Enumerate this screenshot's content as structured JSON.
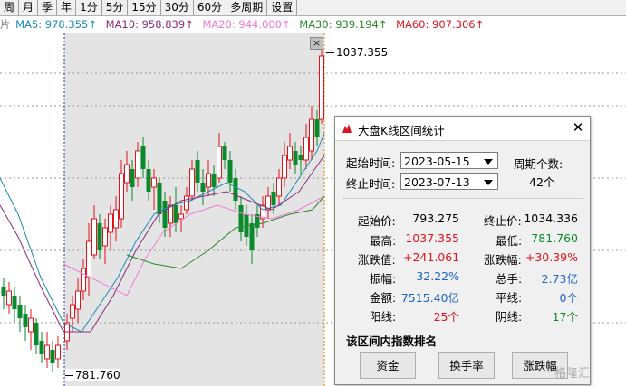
{
  "toolbar": {
    "items": [
      "周",
      "月",
      "季",
      "年",
      "1分",
      "5分",
      "15分",
      "30分",
      "60分",
      "多周期",
      "设置"
    ]
  },
  "ma_legend": {
    "prefix": "片",
    "items": [
      {
        "text": "MA5: 978.355↑",
        "color": "#1b8ab5"
      },
      {
        "text": "MA10: 958.839↑",
        "color": "#8a2b7a"
      },
      {
        "text": "MA20: 944.000↑",
        "color": "#f07ad8"
      },
      {
        "text": "MA30: 939.194↑",
        "color": "#2a8a2a"
      },
      {
        "text": "MA60: 907.306↑",
        "color": "#1a5a9a"
      }
    ]
  },
  "price_labels": {
    "high": "1037.355",
    "low": "781.760"
  },
  "dialog": {
    "title": "大盘K线区间统计",
    "start_label": "起始时间:",
    "start_value": "2023-05-15",
    "end_label": "终止时间:",
    "end_value": "2023-07-13",
    "period_label": "周期个数:",
    "period_value": "42个",
    "stats": {
      "start_price_label": "起始价:",
      "start_price": "793.275",
      "end_price_label": "终止价:",
      "end_price": "1034.336",
      "high_label": "最高:",
      "high": "1037.355",
      "low_label": "最低:",
      "low": "781.760",
      "change_label": "涨跌值:",
      "change": "+241.061",
      "change_pct_label": "涨跌幅:",
      "change_pct": "+30.39%",
      "amplitude_label": "振幅:",
      "amplitude": "32.22%",
      "volume_label": "总手:",
      "volume": "2.73亿",
      "amount_label": "金额:",
      "amount": "7515.40亿",
      "flat_label": "平线:",
      "flat": "0个",
      "up_label": "阳线:",
      "up": "25个",
      "down_label": "阴线:",
      "down": "17个"
    },
    "section_title": "该区间内指数排名",
    "buttons": [
      "资金",
      "换手率",
      "涨跌幅"
    ]
  },
  "watermark": "格隆汇",
  "colors": {
    "up": "#e0141c",
    "down": "#0a8a2a",
    "selection_bg": "#e4e4e4"
  }
}
